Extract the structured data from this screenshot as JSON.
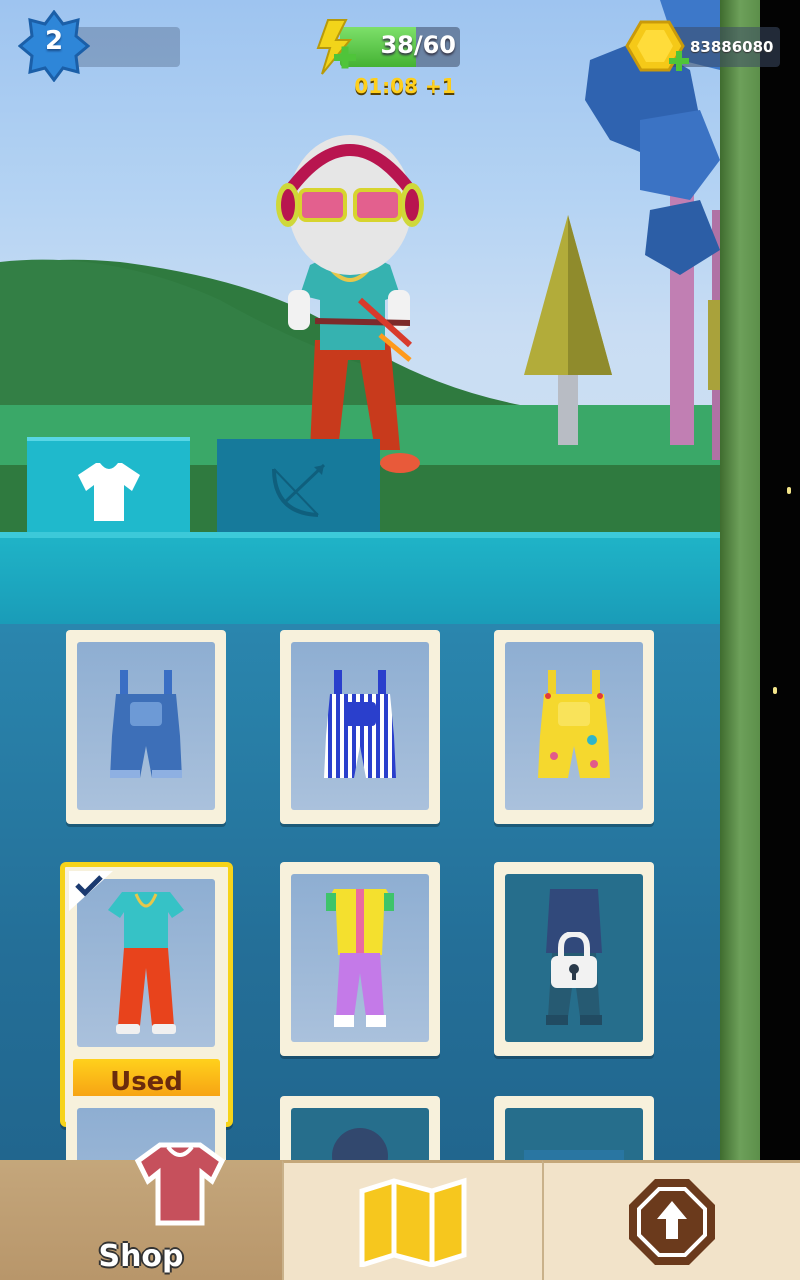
{
  "hud": {
    "level": "2",
    "energy_text": "38/60",
    "energy_fraction": 0.633,
    "timer": "01:08 +1",
    "coins": "83886080"
  },
  "tabs": [
    {
      "name": "outfit",
      "icon": "tshirt-icon",
      "active": true
    },
    {
      "name": "weapon",
      "icon": "bow-icon",
      "active": false
    }
  ],
  "items": [
    {
      "name": "denim-overalls",
      "state": "owned"
    },
    {
      "name": "striped-overalls",
      "state": "owned"
    },
    {
      "name": "floral-overalls",
      "state": "owned"
    },
    {
      "name": "teal-tee-red-pants",
      "state": "used",
      "button_label": "Used"
    },
    {
      "name": "colorful-vest-outfit",
      "state": "owned"
    },
    {
      "name": "dark-outfit",
      "state": "locked"
    }
  ],
  "bottom_nav": {
    "shop_label": "Shop"
  },
  "colors": {
    "panel": "#246f98",
    "tab_active": "#1fb9cc",
    "used_border": "#f6d31a",
    "nav_bg": "#f2e3c9"
  }
}
